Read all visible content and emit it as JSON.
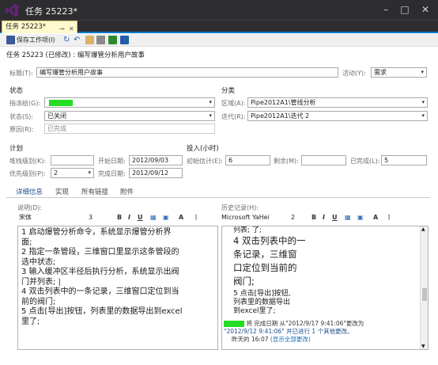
{
  "window": {
    "title": "任务 25223*"
  },
  "tab": {
    "label": "任务 25223*",
    "pin_icon": "pin-icon",
    "close_icon": "close-icon"
  },
  "toolbar": {
    "save_label": "保存工作项(I)"
  },
  "header": {
    "text": "任务 25223 (已修改) : 编写爆管分析用户故事"
  },
  "fields": {
    "title_label": "标题(T):",
    "title_value": "编写爆管分析用户故事",
    "activity_label": "活动(Y):",
    "activity_value": "需求",
    "state_section": "状态",
    "category_section": "分类",
    "assigned_label": "指派给(G):",
    "area_label": "区域(A):",
    "area_value": "Pipe2012A1\\管线分析",
    "status_label": "状态(S):",
    "status_value": "已关闭",
    "iteration_label": "迭代(R):",
    "iteration_value": "Pipe2012A1\\迭代 2",
    "reason_label": "原因(R):",
    "reason_value": "已完成",
    "plan_section": "计划",
    "effort_section": "投入(小时)",
    "stack_label": "堆栈级别(K):",
    "start_label": "开始日期:",
    "start_value": "2012/09/03",
    "priority_label": "优先级别(P):",
    "priority_value": "2",
    "finish_label": "完成日期:",
    "finish_value": "2012/09/12",
    "orig_est_label": "初始估计(E):",
    "orig_est_value": "6",
    "remaining_label": "剩余(M):",
    "remaining_value": "",
    "completed_label": "已完成(L):",
    "completed_value": "5"
  },
  "subtabs": [
    "详细信息",
    "实现",
    "所有链接",
    "附件"
  ],
  "description": {
    "label": "说明(D):",
    "font": "宋体",
    "size": "3",
    "lines": [
      "1 启动爆管分析命令，系统显示爆管分析界",
      "面;",
      "2 指定一条管段，三维窗口里显示这条管段的",
      "选中状态;",
      "3 输入缓冲区半径后执行分析，系统显示出阀",
      "门并列表; |",
      "4 双击列表中的一条记录，三维窗口定位到当",
      "前的阀门;",
      "5 点击[导出]按钮，列表里的数据导出到excel",
      "里了;"
    ]
  },
  "history": {
    "label": "历史记录(H):",
    "font": "Microsoft YaHei",
    "size": "2",
    "top_line": "列表;                    了;",
    "big_lines": [
      "4 双击列表中的一",
      "条记录，三维窗",
      "口定位到当前的",
      "阀门;"
    ],
    "small_lines": [
      "5 点击[导出]按钮,",
      "列表里的数据导出",
      "到excel里了;"
    ],
    "entry_suffix": "将 完成日期 从\"2012/9/17 9:41:06\"更改为",
    "entry_line2": "\"2012/9/12 9:41:06\" 并已进行 1 个其他更改。",
    "entry_time": "昨天的 16:07",
    "entry_link": "(显示全部更改)"
  }
}
